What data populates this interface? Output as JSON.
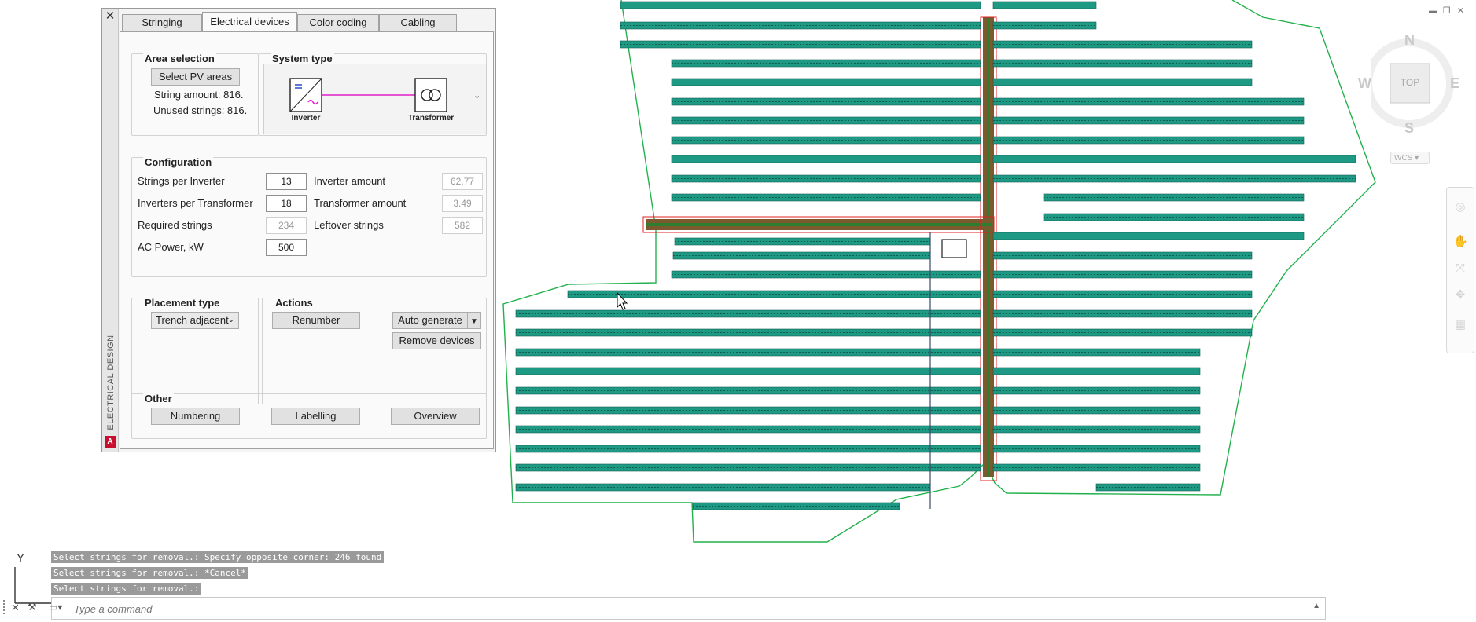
{
  "panel": {
    "side_title": "ELECTRICAL DESIGN",
    "logo_text": "A",
    "close_glyph": "✕",
    "tabs": [
      "Stringing",
      "Electrical devices",
      "Color coding",
      "Cabling"
    ],
    "active_tab": "Electrical devices"
  },
  "area_selection": {
    "title": "Area selection",
    "button": "Select PV areas",
    "string_amount": "String amount: 816.",
    "unused_strings": "Unused strings: 816."
  },
  "system_type": {
    "title": "System type",
    "inverter_label": "Inverter",
    "transformer_label": "Transformer",
    "dropdown_icon": "chevron-down-icon"
  },
  "configuration": {
    "title": "Configuration",
    "strings_per_inverter_label": "Strings per Inverter",
    "strings_per_inverter": "13",
    "inverters_per_transformer_label": "Inverters per Transformer",
    "inverters_per_transformer": "18",
    "required_strings_label": "Required strings",
    "required_strings": "234",
    "ac_power_label": "AC Power, kW",
    "ac_power": "500",
    "inverter_amount_label": "Inverter amount",
    "inverter_amount": "62.77",
    "transformer_amount_label": "Transformer amount",
    "transformer_amount": "3.49",
    "leftover_strings_label": "Leftover strings",
    "leftover_strings": "582"
  },
  "placement_type": {
    "title": "Placement type",
    "selected": "Trench adjacent"
  },
  "actions": {
    "title": "Actions",
    "renumber": "Renumber",
    "auto_generate": "Auto generate",
    "remove_devices": "Remove devices"
  },
  "other": {
    "title": "Other",
    "numbering": "Numbering",
    "labelling": "Labelling",
    "overview": "Overview"
  },
  "viewcube": {
    "north": "N",
    "south": "S",
    "east": "E",
    "west": "W",
    "face": "TOP",
    "ucs": "WCS"
  },
  "command": {
    "history": [
      "Select strings for removal.: Specify opposite corner: 246 found",
      "Select strings for removal.: *Cancel*",
      "Select strings for removal.:"
    ],
    "placeholder": "Type a command"
  },
  "ucs_icon": {
    "y_axis": "Y"
  },
  "colors": {
    "pv_row": "#1e9a84",
    "boundary": "#22b14c",
    "trench": "#8b5a2b",
    "cable_magenta": "#e020c8"
  }
}
